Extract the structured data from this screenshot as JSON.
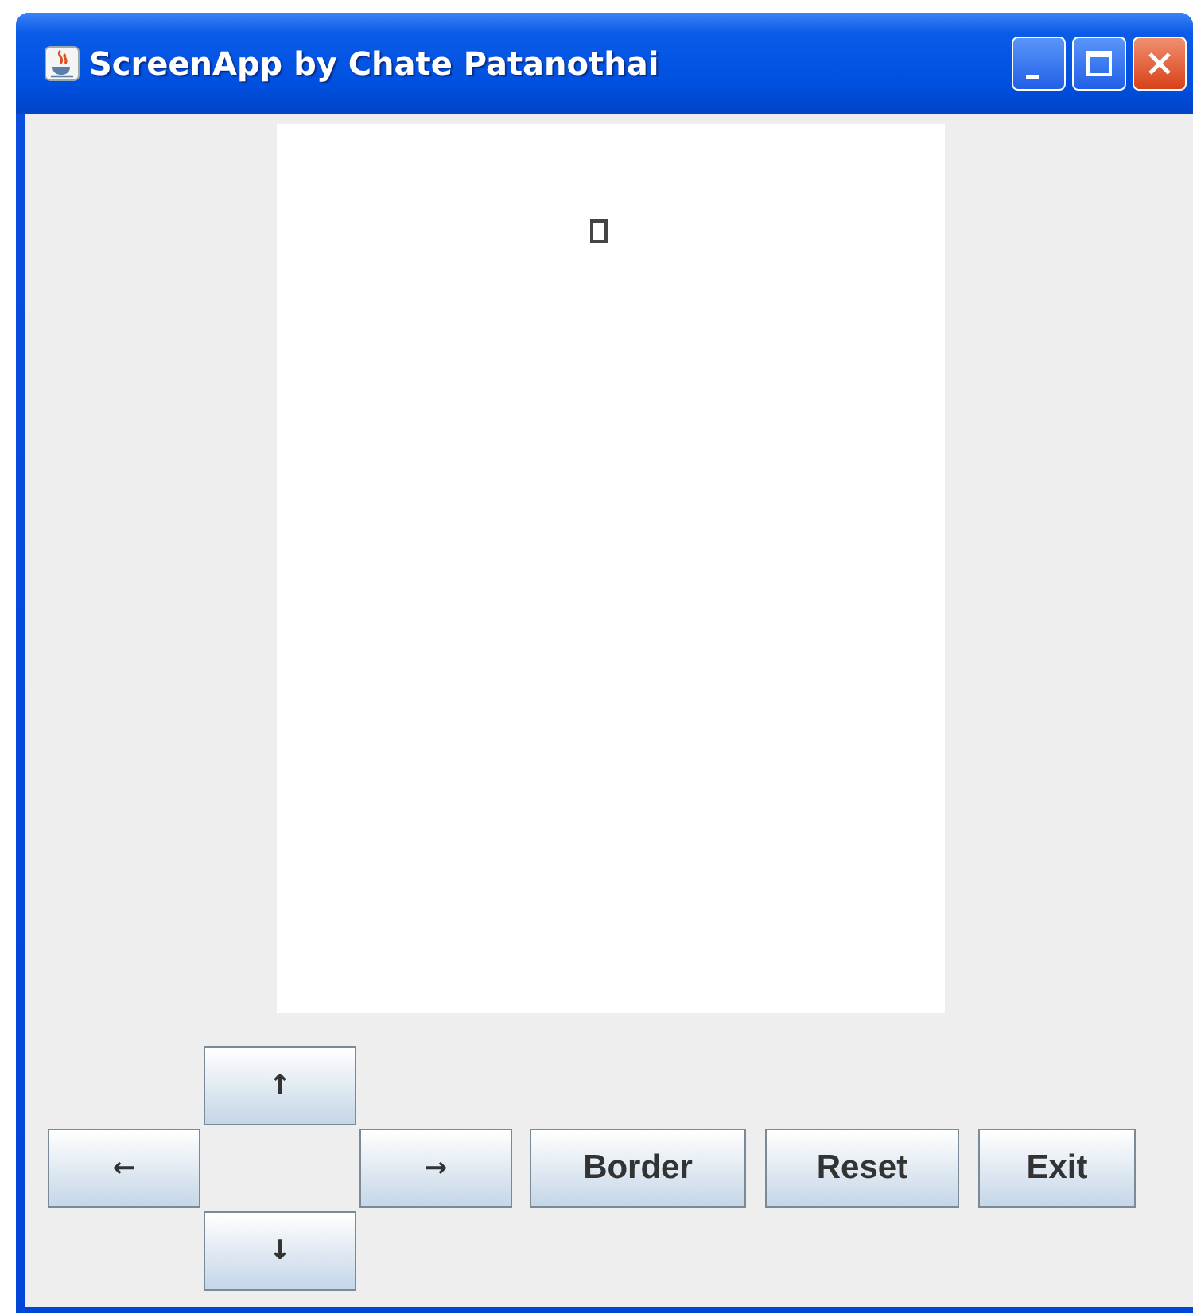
{
  "window": {
    "title": "ScreenApp by Chate Patanothai"
  },
  "canvas": {
    "marker": true
  },
  "arrows": {
    "up": "↑",
    "left": "←",
    "right": "→",
    "down": "↓"
  },
  "buttons": [
    "Border",
    "Reset",
    "Exit"
  ]
}
